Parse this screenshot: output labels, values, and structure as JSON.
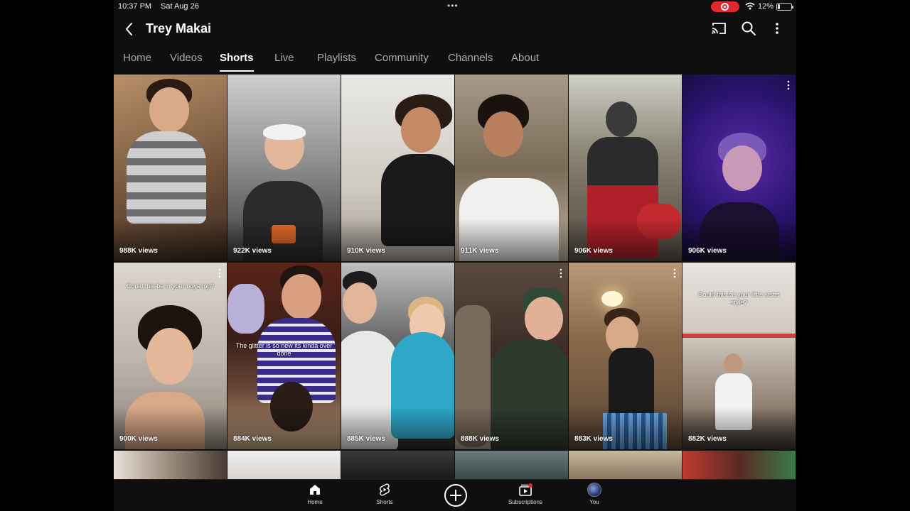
{
  "status_bar": {
    "time": "10:37 PM",
    "date": "Sat Aug 26",
    "dots": "•••",
    "battery": "12%"
  },
  "header": {
    "title": "Trey Makai"
  },
  "tabs": [
    {
      "label": "Home",
      "active": false
    },
    {
      "label": "Videos",
      "active": false
    },
    {
      "label": "Shorts",
      "active": true
    },
    {
      "label": "Live",
      "active": false
    },
    {
      "label": "Playlists",
      "active": false
    },
    {
      "label": "Community",
      "active": false
    },
    {
      "label": "Channels",
      "active": false
    },
    {
      "label": "About",
      "active": false
    }
  ],
  "shorts": [
    {
      "views": "988K views"
    },
    {
      "views": "922K views"
    },
    {
      "views": "910K views"
    },
    {
      "views": "911K views"
    },
    {
      "views": "906K views"
    },
    {
      "views": "906K views"
    },
    {
      "views": "900K views",
      "caption": "Could this be in your boys top?"
    },
    {
      "views": "884K views",
      "caption": "The glitter is so new its kinda over done"
    },
    {
      "views": "885K views"
    },
    {
      "views": "888K views"
    },
    {
      "views": "883K views"
    },
    {
      "views": "882K views",
      "caption": "Could this be your little sister style?"
    }
  ],
  "bottom_nav": {
    "home_label": "Home",
    "shorts_label": "Shorts",
    "subscriptions_label": "Subscriptions",
    "you_label": "You"
  },
  "colors": {
    "background": "#0f0f0f",
    "text": "#ffffff",
    "inactive_tab": "#aaaaaa",
    "record_indicator": "#e0282e"
  }
}
